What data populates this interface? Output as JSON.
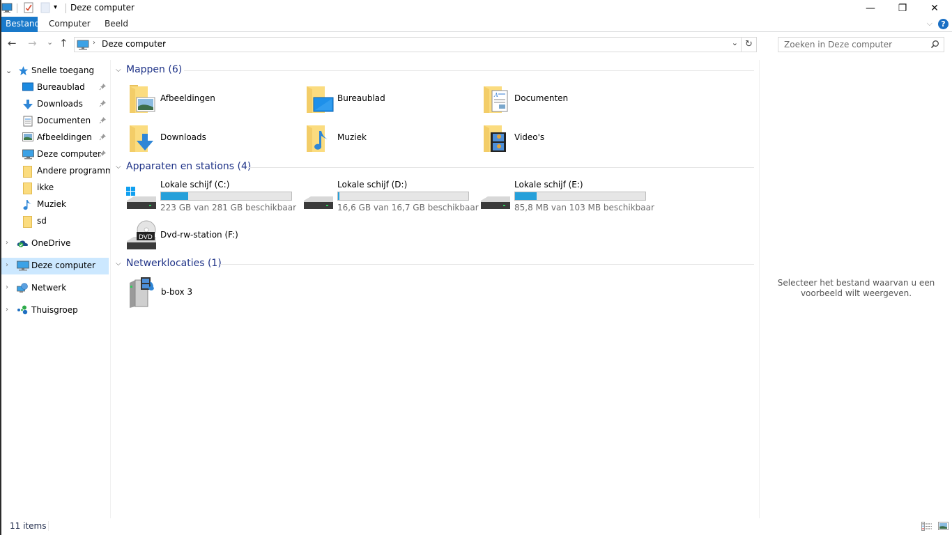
{
  "window": {
    "title": "Deze computer",
    "controls": {
      "minimize": "—",
      "restore": "❐",
      "close": "✕"
    }
  },
  "quick_access_toolbar": {
    "icons": [
      "computer-icon",
      "properties-icon",
      "new-folder-icon",
      "customize-dropdown-icon"
    ]
  },
  "ribbon": {
    "tabs": [
      {
        "label": "Bestand",
        "active": true
      },
      {
        "label": "Computer",
        "active": false
      },
      {
        "label": "Beeld",
        "active": false
      }
    ],
    "expand_icon": "⌵",
    "help_label": "?"
  },
  "navigation": {
    "back": "←",
    "forward": "→",
    "recent": "⌄",
    "up": "↑",
    "address": {
      "separator": "›",
      "path": "Deze computer",
      "dropdown": "⌄",
      "refresh": "↻"
    },
    "search": {
      "placeholder": "Zoeken in Deze computer",
      "value": ""
    }
  },
  "nav_pane": {
    "quick_access": {
      "label": "Snelle toegang",
      "expanded": true,
      "items": [
        {
          "label": "Bureaublad",
          "icon": "desktop-icon",
          "pinned": true
        },
        {
          "label": "Downloads",
          "icon": "downloads-icon",
          "pinned": true
        },
        {
          "label": "Documenten",
          "icon": "documents-icon",
          "pinned": true
        },
        {
          "label": "Afbeeldingen",
          "icon": "pictures-icon",
          "pinned": true
        },
        {
          "label": "Deze computer",
          "icon": "computer-icon",
          "pinned": true
        },
        {
          "label": "Andere programma",
          "icon": "folder-icon",
          "pinned": false
        },
        {
          "label": "ikke",
          "icon": "folder-icon",
          "pinned": false
        },
        {
          "label": "Muziek",
          "icon": "music-icon",
          "pinned": false
        },
        {
          "label": "sd",
          "icon": "folder-icon",
          "pinned": false
        }
      ]
    },
    "roots": [
      {
        "label": "OneDrive",
        "icon": "onedrive-icon",
        "selected": false
      },
      {
        "label": "Deze computer",
        "icon": "computer-icon",
        "selected": true
      },
      {
        "label": "Netwerk",
        "icon": "network-icon",
        "selected": false
      },
      {
        "label": "Thuisgroep",
        "icon": "homegroup-icon",
        "selected": false
      }
    ]
  },
  "content": {
    "groups": {
      "folders": {
        "title": "Mappen (6)",
        "items": [
          {
            "label": "Afbeeldingen",
            "icon": "pictures-folder-icon"
          },
          {
            "label": "Bureaublad",
            "icon": "desktop-folder-icon"
          },
          {
            "label": "Documenten",
            "icon": "documents-folder-icon"
          },
          {
            "label": "Downloads",
            "icon": "downloads-folder-icon"
          },
          {
            "label": "Muziek",
            "icon": "music-folder-icon"
          },
          {
            "label": "Video's",
            "icon": "videos-folder-icon"
          }
        ]
      },
      "devices": {
        "title": "Apparaten en stations (4)",
        "items": [
          {
            "label": "Lokale schijf (C:)",
            "free_text": "223 GB van 281 GB beschikbaar",
            "used_fraction": 0.206,
            "icon": "system-drive-icon"
          },
          {
            "label": "Lokale schijf (D:)",
            "free_text": "16,6 GB van 16,7 GB beschikbaar",
            "used_fraction": 0.006,
            "icon": "drive-icon"
          },
          {
            "label": "Lokale schijf (E:)",
            "free_text": "85,8 MB van 103 MB beschikbaar",
            "used_fraction": 0.167,
            "icon": "drive-icon"
          },
          {
            "label": "Dvd-rw-station (F:)",
            "icon": "dvd-drive-icon"
          }
        ]
      },
      "network": {
        "title": "Netwerklocaties (1)",
        "items": [
          {
            "label": "b-box 3",
            "icon": "media-server-icon"
          }
        ]
      }
    }
  },
  "preview_pane": {
    "message": "Selecteer het bestand waarvan u een voorbeeld wilt weergeven."
  },
  "status_bar": {
    "item_count": "11 items"
  },
  "colors": {
    "accent": "#1979ca",
    "group_title": "#1e3287",
    "selection": "#cce8ff",
    "drive_bar_fill": "#26a0da",
    "folder": "#f8d775"
  }
}
